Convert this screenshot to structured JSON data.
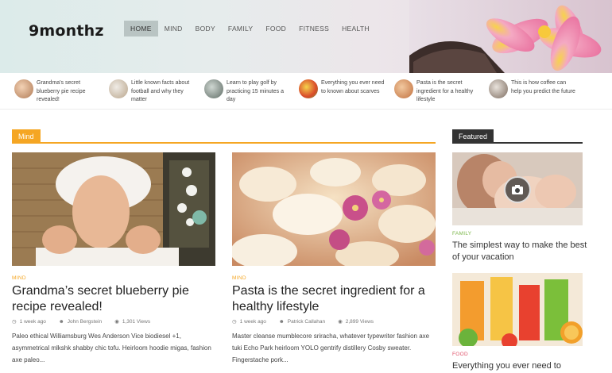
{
  "site": {
    "logo": "9monthz"
  },
  "nav": [
    {
      "label": "HOME",
      "active": true
    },
    {
      "label": "MIND"
    },
    {
      "label": "BODY"
    },
    {
      "label": "FAMILY"
    },
    {
      "label": "FOOD"
    },
    {
      "label": "FITNESS"
    },
    {
      "label": "HEALTH"
    }
  ],
  "ticker": [
    {
      "title": "Grandma's secret blueberry pie recipe revealed!"
    },
    {
      "title": "Little known facts about football and why they matter"
    },
    {
      "title": "Learn to play golf by practicing 15 minutes a day"
    },
    {
      "title": "Everything you ever need to known about scarves"
    },
    {
      "title": "Pasta is the secret ingredient for a healthy lifestyle"
    },
    {
      "title": "This is how coffee can help you predict the future"
    }
  ],
  "section": {
    "label": "Mind"
  },
  "posts": [
    {
      "category": "MIND",
      "title": "Grandma’s secret blueberry pie recipe revealed!",
      "date": "1 week ago",
      "author": "John Bergstein",
      "views": "1,301 Views",
      "excerpt": "Paleo ethical Williamsburg Wes Anderson Vice biodiesel +1, asymmetrical mlkshk shabby chic tofu. Heirloom hoodie migas, fashion axe paleo..."
    },
    {
      "category": "MIND",
      "title": "Pasta is the secret ingredient for a healthy lifestyle",
      "date": "1 week ago",
      "author": "Patrick Callahan",
      "views": "2,899 Views",
      "excerpt": "Master cleanse mumblecore sriracha, whatever typewriter fashion axe tuki Echo Park heirloom YOLO gentrify distillery Cosby sweater. Fingerstache pork..."
    }
  ],
  "featured": {
    "label": "Featured",
    "items": [
      {
        "category": "FAMILY",
        "category_color": "#7ab648",
        "title": "The simplest way to make the best of your vacation"
      },
      {
        "category": "FOOD",
        "category_color": "#e0536b",
        "title": "Everything you ever need to known"
      }
    ]
  },
  "colors": {
    "accent": "#f5a623",
    "dark": "#333333"
  }
}
